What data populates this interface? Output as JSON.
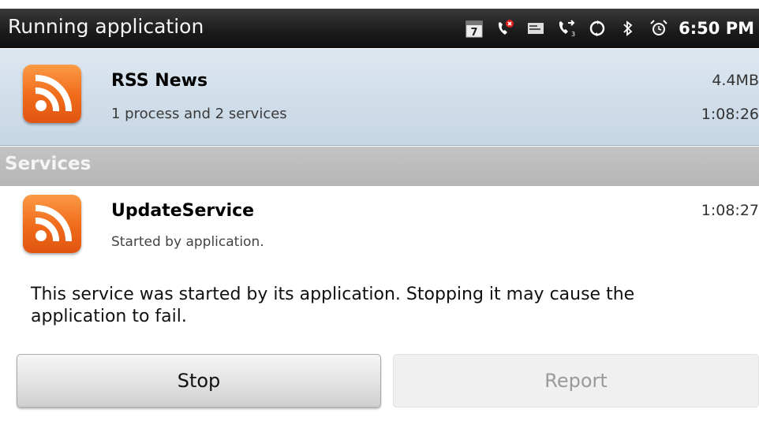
{
  "status_bar": {
    "title": "Running application",
    "time": "6:50 PM",
    "icons": [
      "calendar-icon",
      "missed-call-icon",
      "voicemail-icon",
      "call-forward-icon",
      "sync-icon",
      "bluetooth-icon",
      "alarm-icon"
    ],
    "calendar_day": "7"
  },
  "app": {
    "name": "RSS News",
    "subtitle": "1 process and 2 services",
    "memory": "4.4MB",
    "running_time": "1:08:26"
  },
  "section_header": "Services",
  "service": {
    "name": "UpdateService",
    "subtitle": "Started by application.",
    "running_time": "1:08:27"
  },
  "description": "This service was started by its application. Stopping it may cause the application to fail.",
  "buttons": {
    "stop": "Stop",
    "report": "Report"
  },
  "colors": {
    "rss_orange": "#f06a1a",
    "selected_row": "#d2dfea",
    "section_gray": "#bdbdbd",
    "status_bar": "#1a1a1a"
  }
}
